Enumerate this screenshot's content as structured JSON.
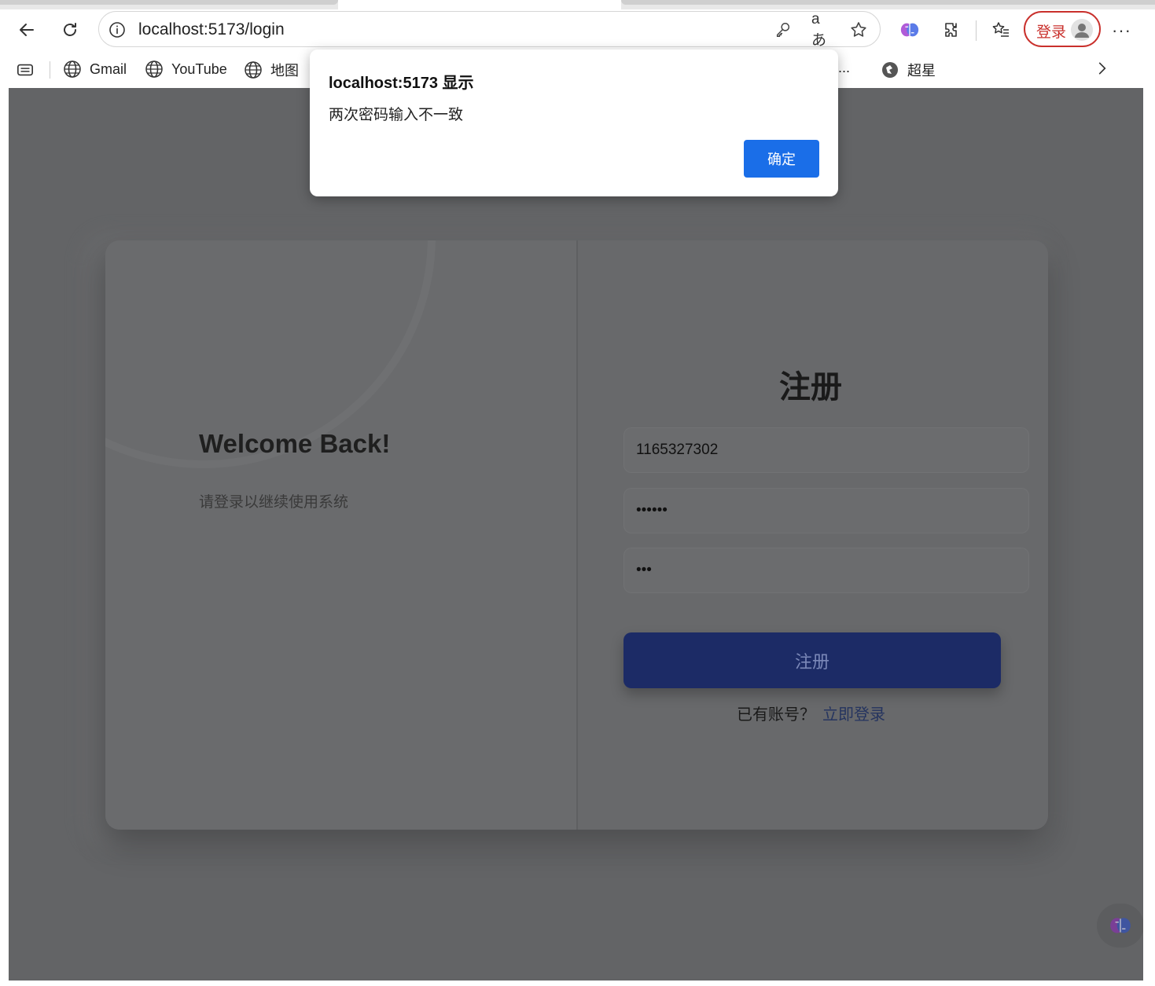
{
  "browser": {
    "url": "localhost:5173/login",
    "profile_label": "登录",
    "bookmarks": [
      {
        "label": "Gmail"
      },
      {
        "label": "YouTube"
      },
      {
        "label": "地图"
      },
      {
        "label": "..."
      },
      {
        "label": "超星"
      }
    ]
  },
  "page": {
    "welcome_title": "Welcome Back!",
    "welcome_subtitle": "请登录以继续使用系统",
    "register_title": "注册",
    "username_value": "1165327302",
    "password_value": "••••••",
    "confirm_value": "•••",
    "register_button": "注册",
    "has_account_text": "已有账号？",
    "login_link": "立即登录"
  },
  "dialog": {
    "title": "localhost:5173 显示",
    "message": "两次密码输入不一致",
    "ok_button": "确定"
  },
  "colors": {
    "overlay": "#636466",
    "primary_button": "#1c2b66",
    "dialog_ok": "#1a6ee8",
    "profile_accent": "#c9302c"
  }
}
